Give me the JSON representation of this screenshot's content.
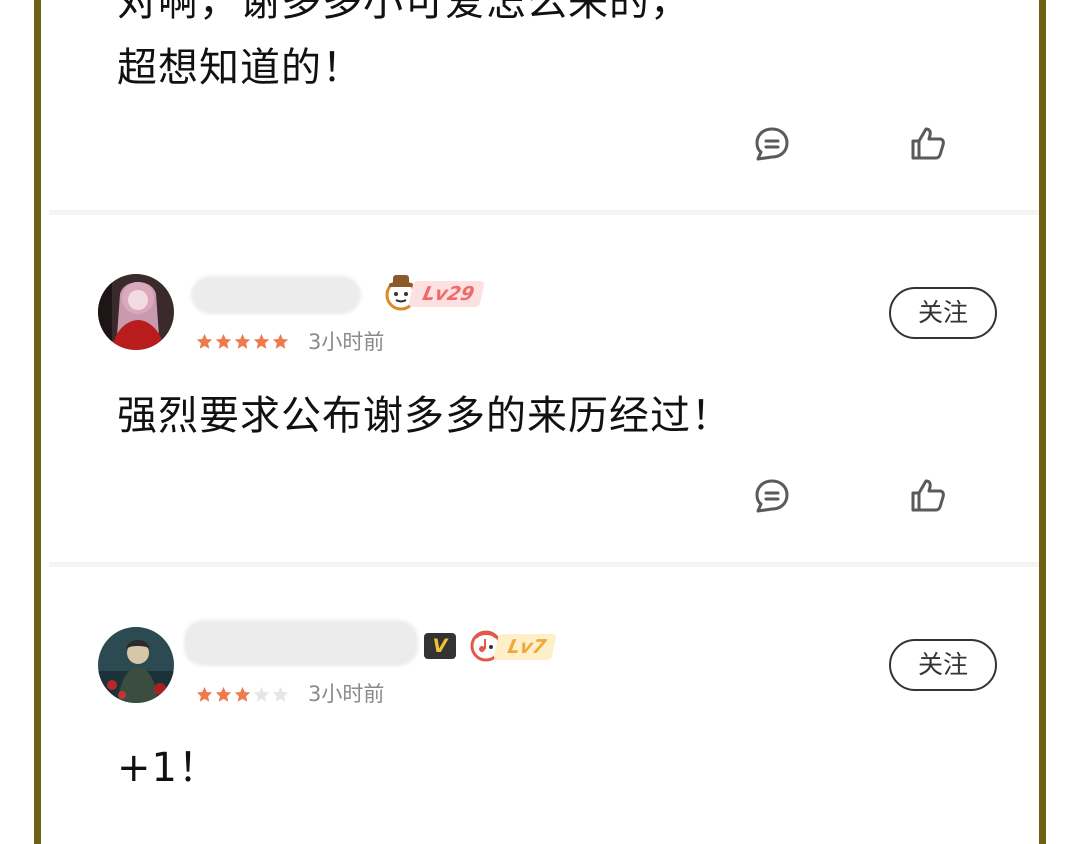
{
  "comments": [
    {
      "text_lines": [
        "对啊，谢多多小可爱怎么来的，",
        "超想知道的！"
      ]
    },
    {
      "level": "Lv29",
      "rating": 5,
      "time": "3小时前",
      "follow_label": "关注",
      "text": "强烈要求公布谢多多的来历经过！"
    },
    {
      "vip": "V",
      "level": "Lv7",
      "rating": 3,
      "time": "3小时前",
      "follow_label": "关注",
      "text": "+1！"
    }
  ],
  "colors": {
    "frame": "#6e6014",
    "star_active": "#ef7a4e",
    "star_inactive": "#e6e6e6",
    "lv29_pill": "#fde1e1",
    "lv29_text": "#ef6a6a",
    "lv7_pill": "#fdf0c8",
    "lv7_text": "#f0a83a"
  },
  "icons": [
    "reply-bubble-icon",
    "thumbs-up-icon",
    "star-icon",
    "chef-hat-badge-icon",
    "music-note-badge-icon"
  ]
}
